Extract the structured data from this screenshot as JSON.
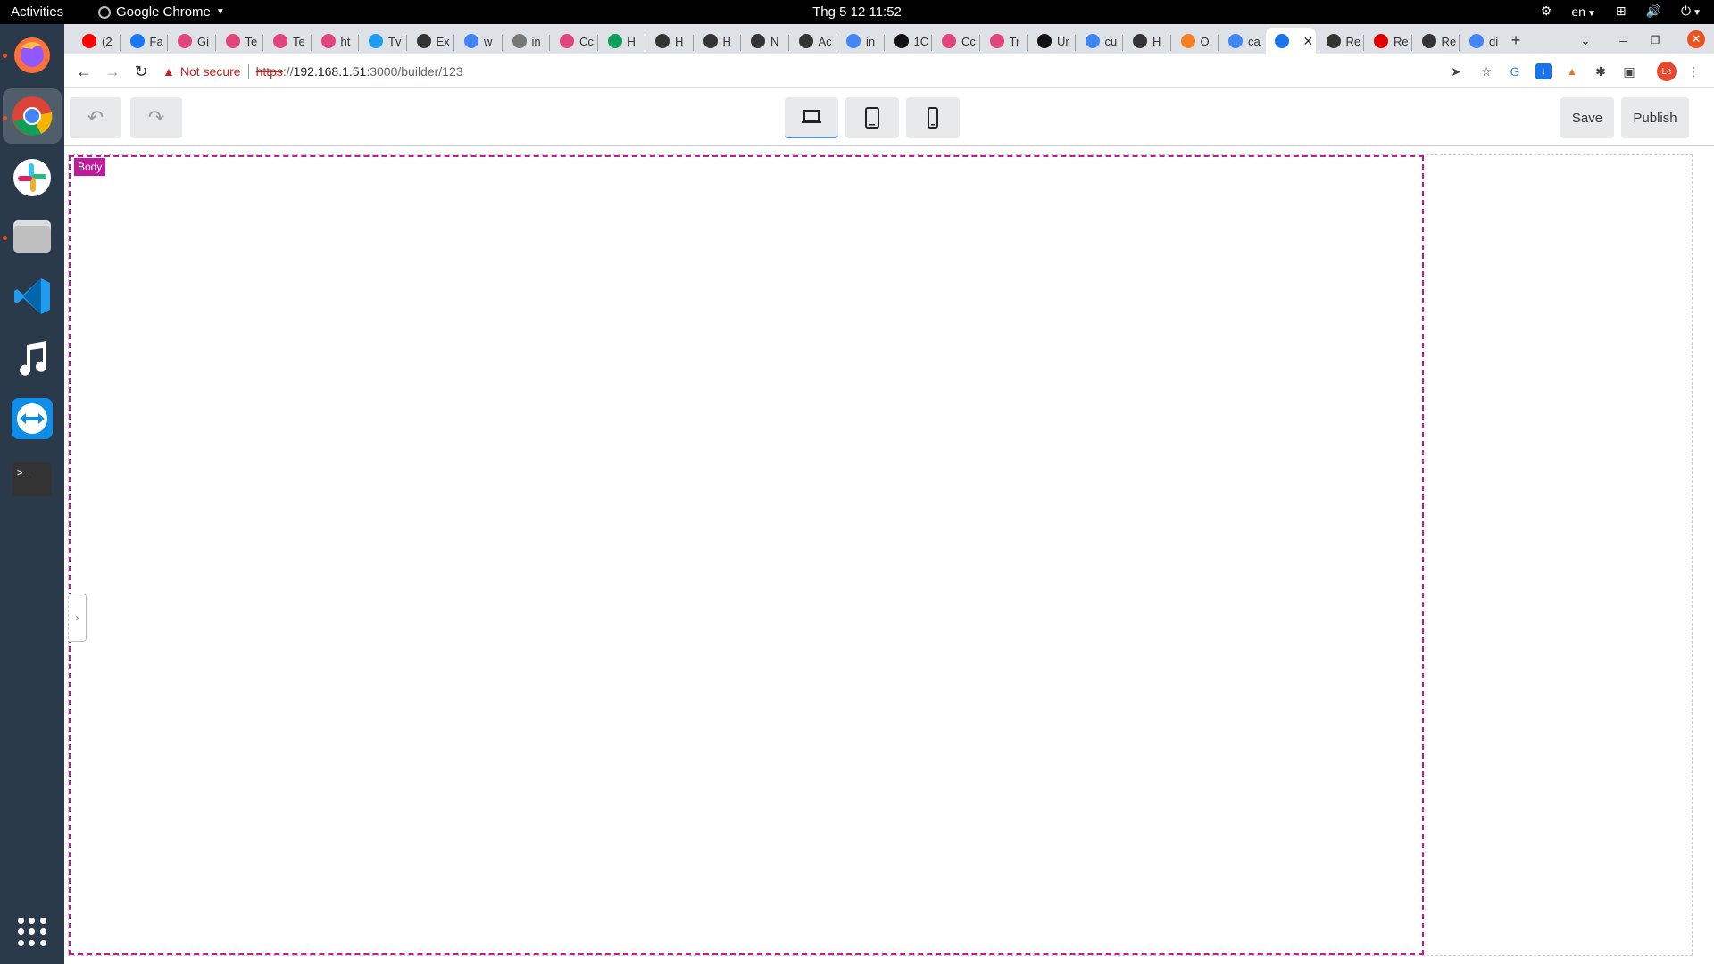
{
  "system": {
    "activities": "Activities",
    "app_name": "Google Chrome",
    "clock": "Thg 5 12  11:52",
    "language": "en"
  },
  "dock": {
    "apps": [
      "firefox-icon",
      "chrome-icon",
      "slack-icon",
      "files-icon",
      "vscode-icon",
      "music-icon",
      "teamviewer-icon",
      "terminal-icon"
    ]
  },
  "tabs": [
    {
      "label": "(2",
      "favicon_color": "#ff0000"
    },
    {
      "label": "Fa",
      "favicon_color": "#1877f2"
    },
    {
      "label": "Gi",
      "favicon_color": "#e0457b"
    },
    {
      "label": "Te",
      "favicon_color": "#e0457b"
    },
    {
      "label": "Te",
      "favicon_color": "#e0457b"
    },
    {
      "label": "ht",
      "favicon_color": "#e0457b"
    },
    {
      "label": "Tv",
      "favicon_color": "#1d9bf0"
    },
    {
      "label": "Ex",
      "favicon_color": "#333333"
    },
    {
      "label": "w",
      "favicon_color": "#4285f4"
    },
    {
      "label": "in",
      "favicon_color": "#777777"
    },
    {
      "label": "Cc",
      "favicon_color": "#e0457b"
    },
    {
      "label": "H",
      "favicon_color": "#0f9d58"
    },
    {
      "label": "H",
      "favicon_color": "#333333"
    },
    {
      "label": "H",
      "favicon_color": "#333333"
    },
    {
      "label": "N",
      "favicon_color": "#333333"
    },
    {
      "label": "Ac",
      "favicon_color": "#333333"
    },
    {
      "label": "in",
      "favicon_color": "#4285f4"
    },
    {
      "label": "1C",
      "favicon_color": "#111111"
    },
    {
      "label": "Cc",
      "favicon_color": "#e0457b"
    },
    {
      "label": "Tr",
      "favicon_color": "#e0457b"
    },
    {
      "label": "Ur",
      "favicon_color": "#111111"
    },
    {
      "label": "cu",
      "favicon_color": "#4285f4"
    },
    {
      "label": "H",
      "favicon_color": "#333333"
    },
    {
      "label": "O",
      "favicon_color": "#f48024"
    },
    {
      "label": "ca",
      "favicon_color": "#4285f4"
    },
    {
      "label": "",
      "favicon_color": "#1a73e8"
    },
    {
      "label": "Re",
      "favicon_color": "#333333"
    },
    {
      "label": "Re",
      "favicon_color": "#e00000"
    },
    {
      "label": "Re",
      "favicon_color": "#333333"
    },
    {
      "label": "di",
      "favicon_color": "#4285f4"
    }
  ],
  "omnibox": {
    "warning": "Not secure",
    "scheme": "https",
    "scheme_sep": "://",
    "host": "192.168.1.51",
    "path": ":3000/builder/123"
  },
  "profile_initials": "Le",
  "builder": {
    "save_label": "Save",
    "publish_label": "Publish",
    "body_tag": "Body",
    "selected_device": "desktop"
  },
  "colors": {
    "accent": "#c2189b",
    "dock": "#2a3a4a",
    "warning": "#c5221f"
  }
}
